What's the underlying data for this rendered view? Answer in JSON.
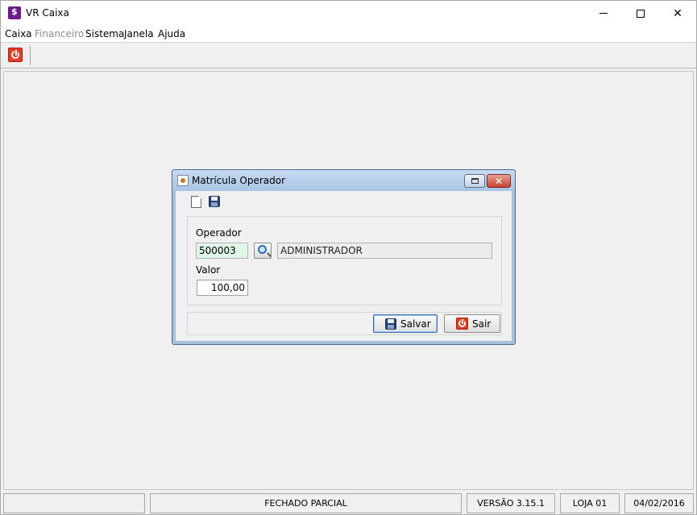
{
  "window": {
    "title": "VR Caixa"
  },
  "menu": [
    {
      "label": "Caixa",
      "enabled": true
    },
    {
      "label": "Financeiro",
      "enabled": false
    },
    {
      "label": "Sistema",
      "enabled": true
    },
    {
      "label": "Janela",
      "enabled": true
    },
    {
      "label": "Ajuda",
      "enabled": true
    }
  ],
  "toolbar": {
    "exit_icon": "power-icon"
  },
  "dialog": {
    "title": "Matrícula Operador",
    "operador_label": "Operador",
    "operador_codigo": "500003",
    "operador_nome": "ADMINISTRADOR",
    "valor_label": "Valor",
    "valor": "100,00",
    "salvar_label": "Salvar",
    "sair_label": "Sair"
  },
  "status": {
    "cell1": "",
    "situacao": "FECHADO PARCIAL",
    "versao": "VERSÃO 3.15.1",
    "loja": "LOJA 01",
    "data": "04/02/2016"
  },
  "colors": {
    "accent_red": "#e53a23",
    "dialog_frame": "#a7c1dd",
    "codigo_field_bg": "#dff7e6"
  }
}
